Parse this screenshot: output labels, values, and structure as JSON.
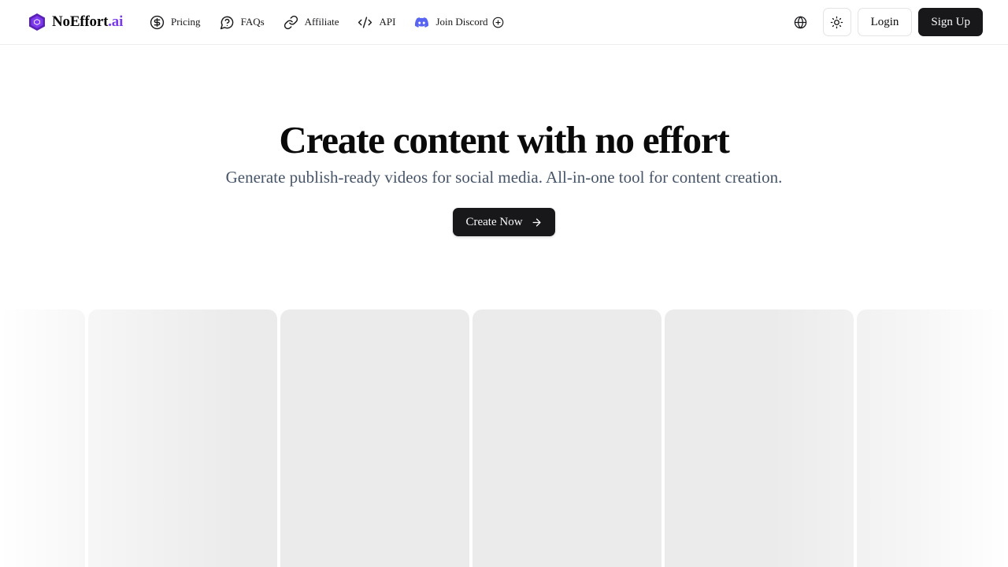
{
  "brand": {
    "name": "NoEffort",
    "tld": ".ai",
    "logo_icon": "hexagon-logo-icon",
    "accent_color": "#7c3aed"
  },
  "nav": {
    "items": [
      {
        "label": "Pricing",
        "icon": "dollar-circle-icon"
      },
      {
        "label": "FAQs",
        "icon": "question-bubble-icon"
      },
      {
        "label": "Affiliate",
        "icon": "link-icon"
      },
      {
        "label": "API",
        "icon": "code-icon"
      },
      {
        "label": "Join Discord",
        "icon": "discord-icon",
        "trailing_icon": "plus-circle-icon",
        "icon_color": "#5865f2"
      }
    ]
  },
  "header_actions": {
    "language_icon": "globe-icon",
    "theme_icon": "sun-icon",
    "login_label": "Login",
    "signup_label": "Sign Up"
  },
  "hero": {
    "title": "Create content with no effort",
    "subtitle": "Generate publish-ready videos for social media. All-in-one tool for content creation.",
    "cta_label": "Create Now",
    "cta_icon": "arrow-right-icon"
  },
  "colors": {
    "primary_dark": "#18181b",
    "subtitle_text": "#475569",
    "tile_placeholder": "#ebebeb"
  }
}
